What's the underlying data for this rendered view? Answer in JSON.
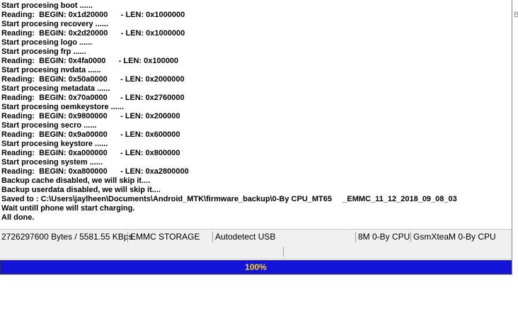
{
  "log": {
    "lines": [
      "Start procesing boot ......",
      "Reading:  BEGIN: 0x1d20000      - LEN: 0x1000000",
      "Start procesing recovery ......",
      "Reading:  BEGIN: 0x2d20000      - LEN: 0x1000000",
      "Start procesing logo ......",
      "Start procesing frp ......",
      "Reading:  BEGIN: 0x4fa0000      - LEN: 0x100000",
      "Start procesing nvdata ......",
      "Reading:  BEGIN: 0x50a0000      - LEN: 0x2000000",
      "Start procesing metadata ......",
      "Reading:  BEGIN: 0x70a0000      - LEN: 0x2760000",
      "Start procesing oemkeystore ......",
      "Reading:  BEGIN: 0x9800000      - LEN: 0x200000",
      "Start procesing secro ......",
      "Reading:  BEGIN: 0x9a00000      - LEN: 0x600000",
      "Start procesing keystore ......",
      "Reading:  BEGIN: 0xa000000      - LEN: 0x800000",
      "Start procesing system ......",
      "Reading:  BEGIN: 0xa800000      - LEN: 0xa2800000",
      "Backup cache disabled, we will skip it....",
      "Backup userdata disabled, we will skip it....",
      "Saved to : C:\\Users\\jaylheen\\Documents\\Android_MTK\\firmware_backup\\0-By CPU_MT65     _EMMC_11_12_2018_09_08_03",
      "Wait untill phone will start charging.",
      "All done."
    ]
  },
  "right_edge_glyph": "B",
  "status": {
    "transfer": "2726297600 Bytes / 5581.55 KBps",
    "storage": "EMMC STORAGE",
    "usb": "Autodetect USB",
    "cpu": "8M 0-By CPU",
    "team": "GsmXteaM 0-By CPU"
  },
  "progress": {
    "label": "100%",
    "fraction": 1.0,
    "fill_color": "#1414d8",
    "text_color": "#ffd800"
  }
}
